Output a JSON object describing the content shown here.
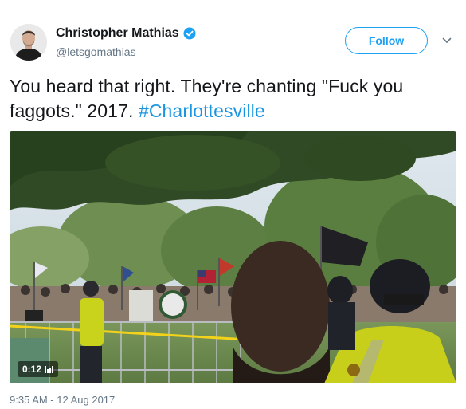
{
  "author": {
    "display_name": "Christopher Mathias",
    "handle": "@letsgomathias",
    "verified": true
  },
  "follow_button": {
    "label": "Follow"
  },
  "tweet": {
    "text_before": "You heard that right. They're chanting \"Fuck you faggots.\" 2017. ",
    "hashtag": "#Charlottesville"
  },
  "media": {
    "duration": "0:12"
  },
  "timestamp": "9:35 AM - 12 Aug 2017",
  "colors": {
    "accent": "#1da1f2",
    "hashtag": "#1b95e0",
    "secondary_text": "#657786"
  }
}
